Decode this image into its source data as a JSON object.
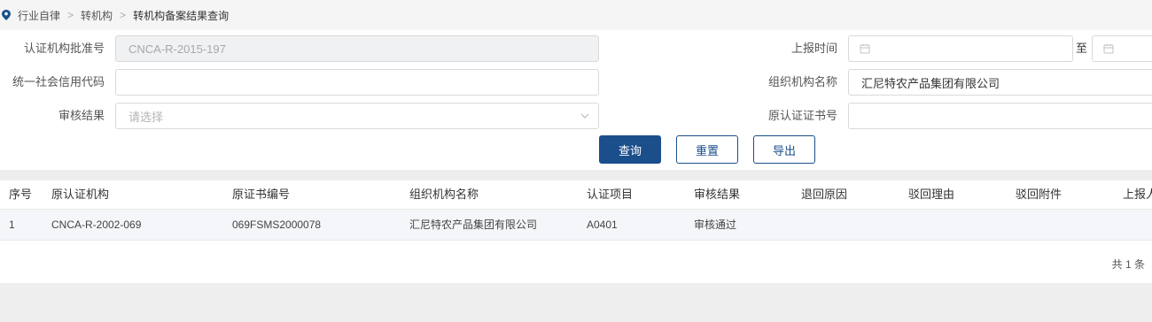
{
  "breadcrumb": {
    "items": [
      "行业自律",
      "转机构",
      "转机构备案结果查询"
    ],
    "separator": ">"
  },
  "form": {
    "approval_no": {
      "label": "认证机构批准号",
      "value": "CNCA-R-2015-197"
    },
    "credit_code": {
      "label": "统一社会信用代码",
      "value": ""
    },
    "review_result": {
      "label": "审核结果",
      "placeholder": "请选择"
    },
    "report_time": {
      "label": "上报时间",
      "range_sep": "至"
    },
    "org_name": {
      "label": "组织机构名称",
      "value": "汇尼特农产品集团有限公司"
    },
    "orig_cert_no": {
      "label": "原认证证书号",
      "value": ""
    }
  },
  "buttons": {
    "query": "查询",
    "reset": "重置",
    "export": "导出"
  },
  "table": {
    "headers": [
      "序号",
      "原认证机构",
      "原证书编号",
      "组织机构名称",
      "认证项目",
      "审核结果",
      "退回原因",
      "驳回理由",
      "驳回附件",
      "上报人"
    ],
    "rows": [
      [
        "1",
        "CNCA-R-2002-069",
        "069FSMS2000078",
        "汇尼特农产品集团有限公司",
        "A0401",
        "审核通过",
        "",
        "",
        "",
        ""
      ]
    ]
  },
  "pagination": {
    "total_text": "共 1 条"
  },
  "colors": {
    "primary": "#1a4f8b",
    "breadcrumb_pin": "#1a4f8b"
  }
}
